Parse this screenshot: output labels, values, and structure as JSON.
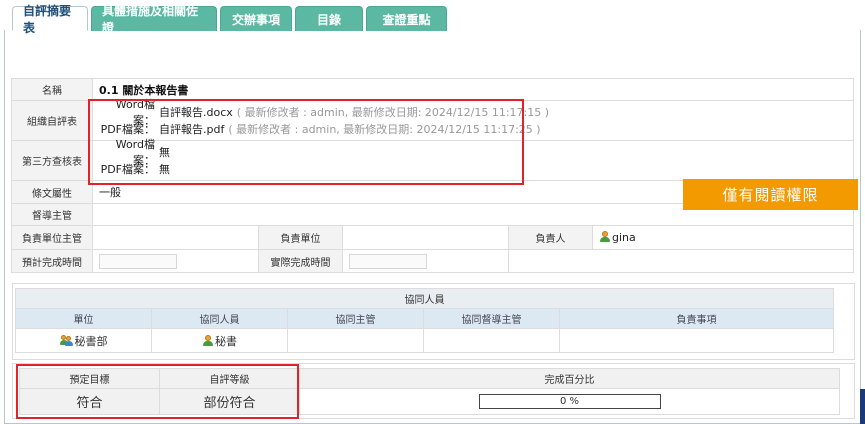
{
  "tabs": [
    {
      "label": "自評摘要表",
      "active": true
    },
    {
      "label": "具體措施及相關佐證",
      "active": false
    },
    {
      "label": "交辦事項",
      "active": false
    },
    {
      "label": "目錄",
      "active": false
    },
    {
      "label": "查證重點",
      "active": false
    }
  ],
  "table": {
    "name_label": "名稱",
    "name_value": "0.1 關於本報告書",
    "self_eval_label": "組織自評表",
    "third_party_label": "第三方查核表",
    "word_label": "Word檔案：",
    "pdf_label": "PDF檔案：",
    "self_eval": {
      "word_file": "自評報告.docx",
      "word_meta": "( 最新修改者 : admin, 最新修改日期: 2024/12/15 11:17:15 )",
      "pdf_file": "自評報告.pdf",
      "pdf_meta": "( 最新修改者 : admin, 最新修改日期: 2024/12/15 11:17:25 )"
    },
    "third_party": {
      "word_value": "無",
      "pdf_value": "無"
    },
    "clause_label": "條文屬性",
    "clause_value": "一般",
    "supervisor_label": "督導主管",
    "supervisor_value": "",
    "unit_head_label": "負責單位主管",
    "unit_label": "負責單位",
    "owner_label": "負責人",
    "owner_value": "gina",
    "planned_date_label": "預計完成時間",
    "actual_date_label": "實際完成時間"
  },
  "badge": "僅有閱讀權限",
  "collab": {
    "title": "協同人員",
    "columns": [
      "單位",
      "協同人員",
      "協同主管",
      "協同督導主管",
      "負責事項"
    ],
    "row": {
      "unit": "秘書部",
      "person": "秘書",
      "manager": "",
      "supervisor": "",
      "duty": ""
    }
  },
  "bottom": {
    "target_label": "預定目標",
    "level_label": "自評等級",
    "percent_label": "完成百分比",
    "target_value": "符合",
    "level_value": "部份符合",
    "percent_value": "0 %"
  },
  "colors": {
    "tab": "#5ab8a3",
    "highlight": "#e0232a",
    "badge": "#f29a00"
  }
}
